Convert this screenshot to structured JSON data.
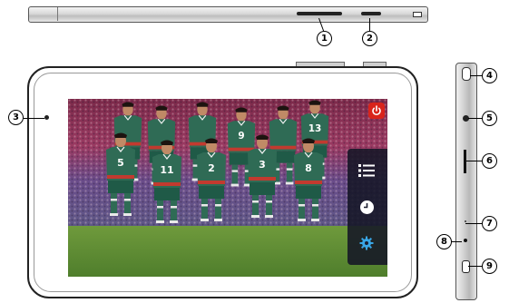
{
  "callouts": [
    {
      "number": "1"
    },
    {
      "number": "2"
    },
    {
      "number": "3"
    },
    {
      "number": "4"
    },
    {
      "number": "5"
    },
    {
      "number": "6"
    },
    {
      "number": "7"
    },
    {
      "number": "8"
    },
    {
      "number": "9"
    }
  ],
  "screen": {
    "jersey_numbers": [
      "5",
      "11",
      "2",
      "3",
      "8",
      "9",
      "13"
    ],
    "power_button_color": "#d9241b",
    "panel_icons": [
      "menu-list-icon",
      "clock-icon",
      "settings-gear-icon"
    ],
    "jersey_color": "#2f6b55",
    "shorts_color": "#1f5a47"
  }
}
